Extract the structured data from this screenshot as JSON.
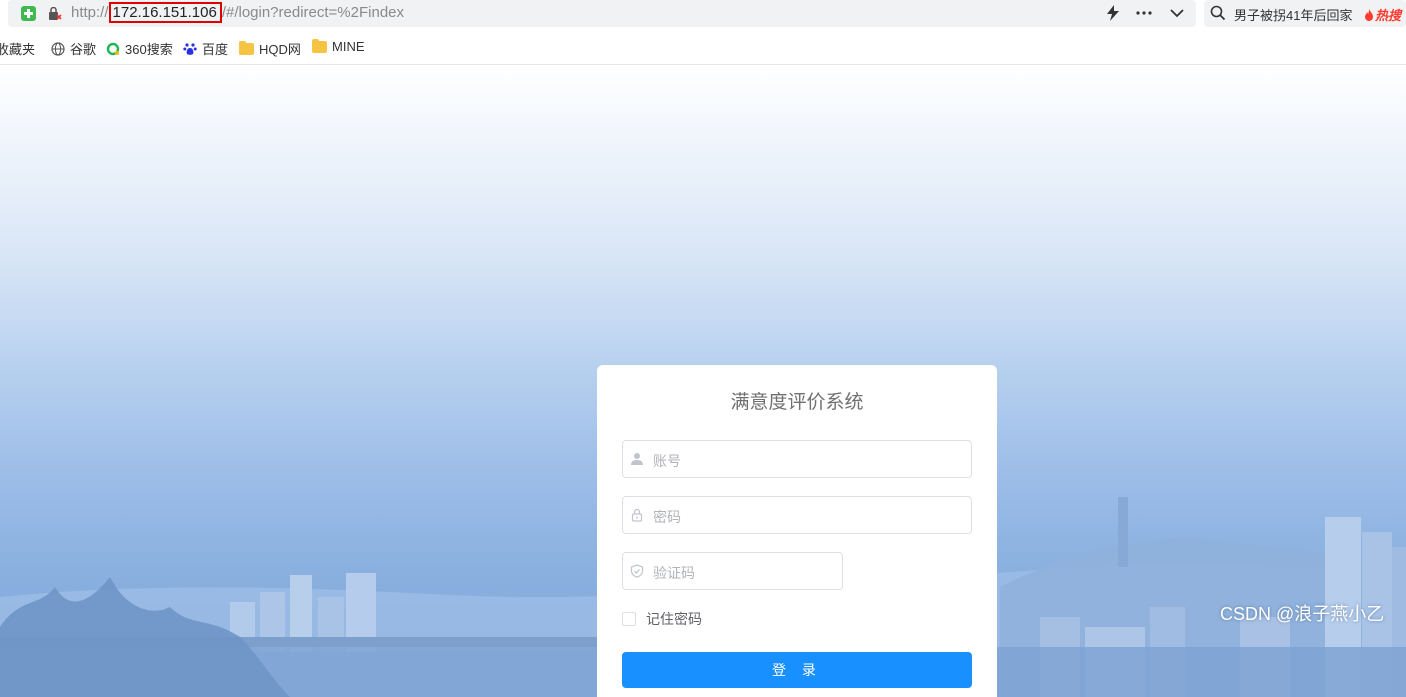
{
  "browser": {
    "url_prefix": "http://",
    "url_host": "172.16.151.106",
    "url_suffix": "/#/login?redirect=%2Findex",
    "search_text": "男子被拐41年后回家",
    "search_hot_label": "热搜",
    "icons": [
      "security-shield-icon",
      "noscript-icon",
      "lightning-icon",
      "more-icon",
      "chevron-down-icon",
      "search-icon",
      "fire-icon"
    ]
  },
  "bookmarks": {
    "items": [
      {
        "label": "收藏夹",
        "icon": "star-icon"
      },
      {
        "label": "谷歌",
        "icon": "globe-icon"
      },
      {
        "label": "360搜索",
        "icon": "search360-icon"
      },
      {
        "label": "百度",
        "icon": "baidu-paw-icon"
      },
      {
        "label": "HQD网",
        "icon": "folder-icon"
      },
      {
        "label": "MINE",
        "icon": "folder-icon"
      }
    ]
  },
  "login": {
    "title": "满意度评价系统",
    "username_placeholder": "账号",
    "password_placeholder": "密码",
    "captcha_placeholder": "验证码",
    "remember_label": "记住密码",
    "submit_label": "登 录"
  },
  "watermark": "CSDN @浪子燕小乙",
  "colors": {
    "primary_button": "#1890ff",
    "highlight_border": "#e00000",
    "hot_text": "#ff3b30"
  }
}
